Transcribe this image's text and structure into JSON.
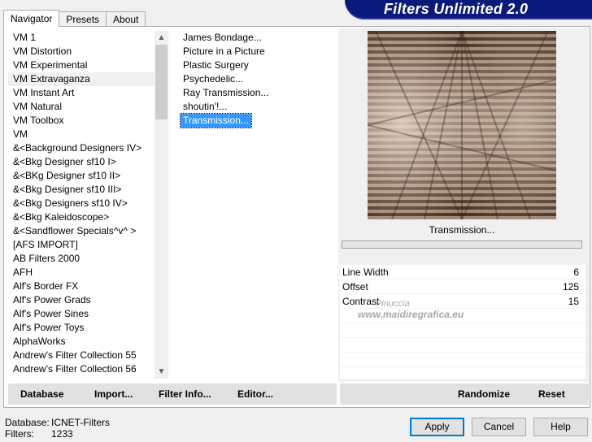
{
  "tabs": [
    "Navigator",
    "Presets",
    "About"
  ],
  "banner_title": "Filters Unlimited 2.0",
  "categories": [
    "VM 1",
    "VM Distortion",
    "VM Experimental",
    "VM Extravaganza",
    "VM Instant Art",
    "VM Natural",
    "VM Toolbox",
    "VM",
    "&<Background Designers IV>",
    "&<Bkg Designer sf10 I>",
    "&<BKg Designer sf10 II>",
    "&<Bkg Designer sf10 III>",
    "&<Bkg Designers sf10 IV>",
    "&<Bkg Kaleidoscope>",
    "&<Sandflower Specials^v^ >",
    "[AFS IMPORT]",
    "AB Filters 2000",
    "AFH",
    "Alf's Border FX",
    "Alf's Power Grads",
    "Alf's Power Sines",
    "Alf's Power Toys",
    "AlphaWorks",
    "Andrew's Filter Collection 55",
    "Andrew's Filter Collection 56"
  ],
  "selected_category": "VM Extravaganza",
  "filters": [
    "James Bondage...",
    "Picture in a Picture",
    "Plastic Surgery",
    "Psychedelic...",
    "Ray Transmission...",
    "shoutin'!...",
    "Transmission..."
  ],
  "selected_filter": "Transmission...",
  "preview": {
    "filter_name": "Transmission...",
    "progress": 0
  },
  "params": [
    {
      "name": "Line Width",
      "value": "6"
    },
    {
      "name": "Offset",
      "value": "125"
    },
    {
      "name": "Contrast",
      "value": "15"
    }
  ],
  "watermark": {
    "line1": "Pinuccia",
    "line2": "www.maidiregrafica.eu"
  },
  "toolbar": {
    "database": "Database",
    "import": "Import...",
    "filter_info": "Filter Info...",
    "editor": "Editor...",
    "randomize": "Randomize",
    "reset": "Reset"
  },
  "status": {
    "database_label": "Database:",
    "database_value": "ICNET-Filters",
    "filters_label": "Filters:",
    "filters_value": "1233"
  },
  "buttons": {
    "apply": "Apply",
    "cancel": "Cancel",
    "help": "Help"
  },
  "colors": {
    "banner_bg": "#0a1a7a",
    "selection": "#3399ff",
    "default_button_border": "#0078d7"
  }
}
